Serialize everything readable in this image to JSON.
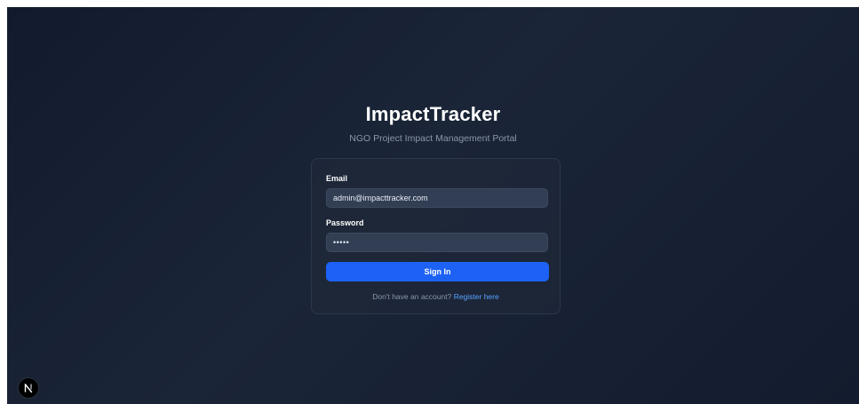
{
  "app": {
    "title": "ImpactTracker",
    "subtitle": "NGO Project Impact Management Portal"
  },
  "login_form": {
    "email_label": "Email",
    "email_value": "admin@impacttracker.com",
    "password_label": "Password",
    "password_value": "admin",
    "submit_label": "Sign In",
    "register_prompt": "Don't have an account?",
    "register_link": "Register here"
  },
  "dev_badge": {
    "icon": "nextjs-logo-icon"
  },
  "colors": {
    "background": "#172133",
    "card_border": "#2c3849",
    "input_background": "#313e54",
    "primary_button": "#1d62f4",
    "link": "#5aa2ff",
    "muted_text": "#8b97aa"
  }
}
